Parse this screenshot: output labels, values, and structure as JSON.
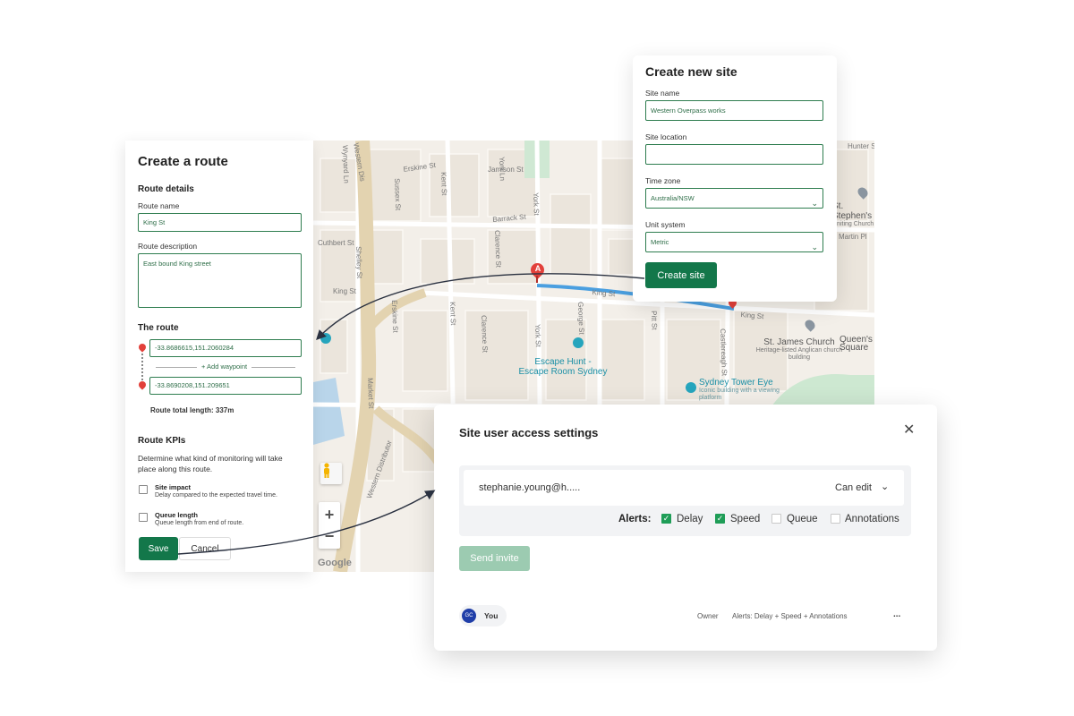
{
  "route_panel": {
    "title": "Create a route",
    "details_heading": "Route details",
    "route_name_label": "Route name",
    "route_name_value": "King St",
    "route_description_label": "Route description",
    "route_description_value": "East bound King street",
    "the_route_heading": "The route",
    "waypoint_a_value": "-33.8686615,151.2060284",
    "add_waypoint_label": "+ Add waypoint",
    "waypoint_b_value": "-33.8690208,151.209651",
    "total_length": "Route total length: 337m",
    "kpis_heading": "Route KPIs",
    "kpis_description": "Determine what kind of monitoring will take place along this route.",
    "kpis": [
      {
        "title": "Site impact",
        "description": "Delay compared to the expected travel time.",
        "checked": false
      },
      {
        "title": "Queue length",
        "description": "Queue length from end of route.",
        "checked": false
      }
    ],
    "save_label": "Save",
    "cancel_label": "Cancel"
  },
  "map": {
    "marker_a": "A",
    "zoom_in": "+",
    "zoom_out": "−",
    "attribution": "Google",
    "streets": [
      "Western Dis",
      "Erskine St",
      "Jamison St",
      "Sussex St",
      "Kent St",
      "Wynyard Ln",
      "York Ln",
      "York St",
      "Barrack St",
      "Clarence St",
      "Cuthbert St",
      "Shelley St",
      "King St",
      "King St",
      "Kent St",
      "Erskine St",
      "George St",
      "Pitt St",
      "Castlereagh St",
      "King St",
      "York St",
      "Clarence St",
      "Market St",
      "Western Distributor",
      "Hunter St",
      "Martin Pl",
      "Queen's Square"
    ],
    "pois": [
      {
        "name": "Escape Hunt -",
        "sub": "Escape Room Sydney"
      },
      {
        "name": "Sydney Tower Eye",
        "sub": "Iconic building with a viewing platform"
      }
    ],
    "places": [
      {
        "name": "St. James Church",
        "sub": "Heritage-listed Anglican church building"
      },
      {
        "name": "St. Stephen's",
        "sub": "Uniting Church"
      },
      {
        "name": "Queen's",
        "sub": "Square"
      }
    ]
  },
  "site_panel": {
    "title": "Create new site",
    "site_name_label": "Site name",
    "site_name_value": "Western Overpass works",
    "site_location_label": "Site location",
    "site_location_value": "",
    "time_zone_label": "Time zone",
    "time_zone_value": "Australia/NSW",
    "unit_system_label": "Unit system",
    "unit_system_value": "Metric",
    "create_label": "Create site"
  },
  "access_panel": {
    "title": "Site user access settings",
    "email_value": "stephanie.young@h.....",
    "permission_value": "Can edit",
    "alerts_label": "Alerts:",
    "alerts": [
      {
        "label": "Delay",
        "checked": true
      },
      {
        "label": "Speed",
        "checked": true
      },
      {
        "label": "Queue",
        "checked": false
      },
      {
        "label": "Annotations",
        "checked": false
      }
    ],
    "send_label": "Send invite",
    "user_initials": "GC",
    "user_name": "You",
    "user_role": "Owner",
    "user_alerts": "Alerts: Delay + Speed + Annotations",
    "more_label": "..."
  },
  "colors": {
    "brand_green": "#13774a",
    "route_blue": "#4a9fe0",
    "marker_red": "#e2403a",
    "checkbox_green": "#1f9d57",
    "avatar_blue": "#1f3ea8"
  }
}
